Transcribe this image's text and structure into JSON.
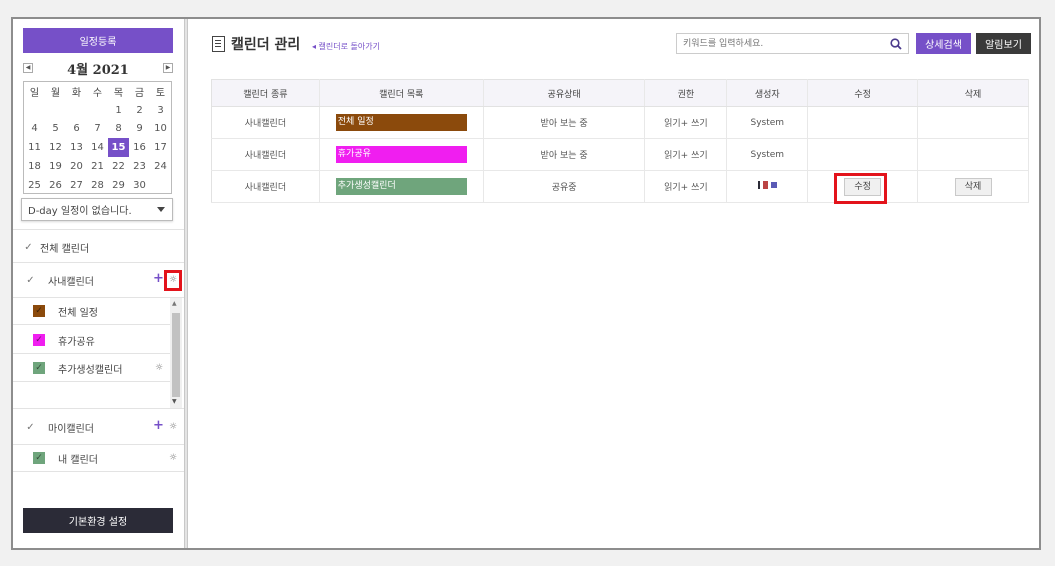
{
  "sidebar": {
    "register_label": "일정등록",
    "calendar": {
      "title": "4월 2021",
      "prev_icon": "prev-arrow-icon",
      "next_icon": "next-arrow-icon",
      "weekdays": [
        "일",
        "월",
        "화",
        "수",
        "목",
        "금",
        "토"
      ],
      "weeks": [
        [
          "",
          "",
          "",
          "",
          "1",
          "2",
          "3"
        ],
        [
          "4",
          "5",
          "6",
          "7",
          "8",
          "9",
          "10"
        ],
        [
          "11",
          "12",
          "13",
          "14",
          "15",
          "16",
          "17"
        ],
        [
          "18",
          "19",
          "20",
          "21",
          "22",
          "23",
          "24"
        ],
        [
          "25",
          "26",
          "27",
          "28",
          "29",
          "30",
          ""
        ]
      ],
      "today": "15",
      "today_color": "#7650c8"
    },
    "dday_label": "D-day 일정이 없습니다.",
    "all_calendars_label": "전체 캘린더",
    "company_group": {
      "label": "사내캘린더",
      "items": [
        {
          "label": "전체 일정",
          "color": "#8b4a0c",
          "has_gear": false
        },
        {
          "label": "휴가공유",
          "color": "#f01ef0",
          "has_gear": false
        },
        {
          "label": "추가생성캘린더",
          "color": "#6fa57c",
          "has_gear": true
        }
      ]
    },
    "my_group": {
      "label": "마이캘린더",
      "items": [
        {
          "label": "내 캘린더",
          "color": "#6fa57c",
          "has_gear": true
        }
      ]
    },
    "settings_label": "기본환경 설정"
  },
  "main": {
    "title": "캘린더 관리",
    "back_link": "◂ 캘린더로 돌아가기",
    "search_placeholder": "키워드를 입력하세요.",
    "search_icon": "search-icon",
    "adv_search_label": "상세검색",
    "alarm_label": "알림보기",
    "accent_color": "#7650c8",
    "table": {
      "headers": [
        "캘린더 종류",
        "캘린더 목록",
        "공유상태",
        "권한",
        "생성자",
        "수정",
        "삭제"
      ],
      "rows": [
        {
          "type": "사내캘린더",
          "name": "전체 일정",
          "color": "#8b4a0c",
          "share": "받아 보는 중",
          "perm": "읽기+ 쓰기",
          "creator": "System",
          "edit": "",
          "delete": ""
        },
        {
          "type": "사내캘린더",
          "name": "휴가공유",
          "color": "#f01ef0",
          "share": "받아 보는 중",
          "perm": "읽기+ 쓰기",
          "creator": "System",
          "edit": "",
          "delete": ""
        },
        {
          "type": "사내캘린더",
          "name": "추가생성캘린더",
          "color": "#6fa57c",
          "share": "공유중",
          "perm": "읽기+ 쓰기",
          "creator": "",
          "edit": "수정",
          "delete": "삭제"
        }
      ]
    }
  }
}
